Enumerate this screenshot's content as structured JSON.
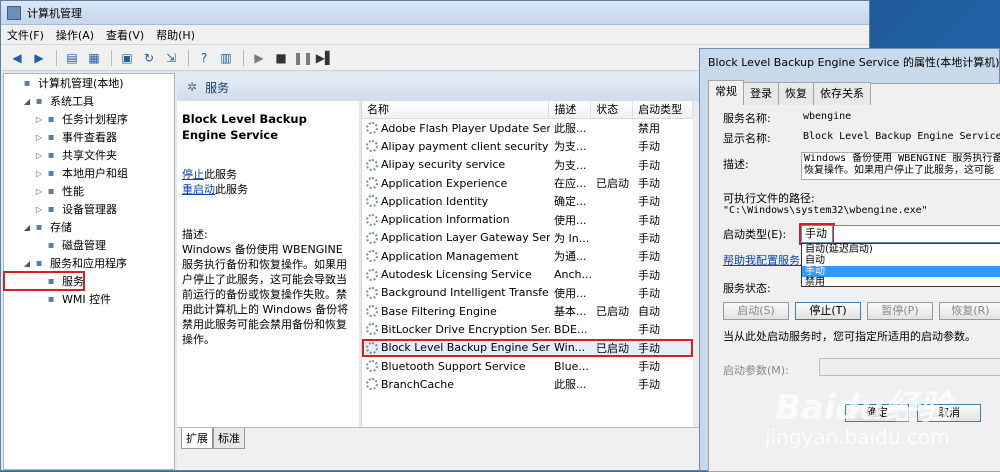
{
  "main_title": "计算机管理",
  "menu": [
    "文件(F)",
    "操作(A)",
    "查看(V)",
    "帮助(H)"
  ],
  "tree": [
    {
      "label": "计算机管理(本地)",
      "level": 0
    },
    {
      "label": "系统工具",
      "level": 1
    },
    {
      "label": "任务计划程序",
      "level": 2
    },
    {
      "label": "事件查看器",
      "level": 2
    },
    {
      "label": "共享文件夹",
      "level": 2
    },
    {
      "label": "本地用户和组",
      "level": 2
    },
    {
      "label": "性能",
      "level": 2
    },
    {
      "label": "设备管理器",
      "level": 2
    },
    {
      "label": "存储",
      "level": 1
    },
    {
      "label": "磁盘管理",
      "level": 2
    },
    {
      "label": "服务和应用程序",
      "level": 1
    },
    {
      "label": "服务",
      "level": 2,
      "selected": true
    },
    {
      "label": "WMI 控件",
      "level": 2
    }
  ],
  "services_header": "服务",
  "detail": {
    "title": "Block Level Backup Engine Service",
    "stop_link": "停止",
    "stop_rest": "此服务",
    "restart_link": "重启动",
    "restart_rest": "此服务",
    "desc_label": "描述:",
    "desc_text": "Windows 备份使用 WBENGINE 服务执行备份和恢复操作。如果用户停止了此服务，这可能会导致当前运行的备份或恢复操作失败。禁用此计算机上的 Windows 备份将禁用此服务可能会禁用备份和恢复操作。"
  },
  "columns": [
    "名称",
    "描述",
    "状态",
    "启动类型"
  ],
  "rows": [
    [
      "Adobe Flash Player Update Ser...",
      "此服...",
      "",
      "禁用"
    ],
    [
      "Alipay payment client security ...",
      "为支...",
      "",
      "手动"
    ],
    [
      "Alipay security service",
      "为支...",
      "",
      "手动"
    ],
    [
      "Application Experience",
      "在应...",
      "已启动",
      "手动"
    ],
    [
      "Application Identity",
      "确定...",
      "",
      "手动"
    ],
    [
      "Application Information",
      "使用...",
      "",
      "手动"
    ],
    [
      "Application Layer Gateway Ser...",
      "为 In...",
      "",
      "手动"
    ],
    [
      "Application Management",
      "为通...",
      "",
      "手动"
    ],
    [
      "Autodesk Licensing Service",
      "Anch...",
      "",
      "手动"
    ],
    [
      "Background Intelligent Transfe...",
      "使用...",
      "",
      "手动"
    ],
    [
      "Base Filtering Engine",
      "基本...",
      "已启动",
      "自动"
    ],
    [
      "BitLocker Drive Encryption Ser...",
      "BDE...",
      "",
      "手动"
    ],
    [
      "Block Level Backup Engine Ser...",
      "Win...",
      "已启动",
      "手动"
    ],
    [
      "Bluetooth Support Service",
      "Blue...",
      "",
      "手动"
    ],
    [
      "BranchCache",
      "此服...",
      "",
      "手动"
    ]
  ],
  "bottom_tabs": [
    "扩展",
    "标准"
  ],
  "dialog": {
    "title": "Block Level Backup Engine Service 的属性(本地计算机)",
    "tabs": [
      "常规",
      "登录",
      "恢复",
      "依存关系"
    ],
    "svc_name_label": "服务名称:",
    "svc_name": "wbengine",
    "disp_name_label": "显示名称:",
    "disp_name": "Block Level Backup Engine Service",
    "desc_label": "描述:",
    "desc1": "Windows 备份使用 WBENGINE 服务执行备份",
    "desc2": "恢复操作。如果用户停止了此服务，这可能",
    "path_label": "可执行文件的路径:",
    "path": "\"C:\\Windows\\system32\\wbengine.exe\"",
    "startup_label": "启动类型(E):",
    "startup_value": "手动",
    "options": [
      "自动(延迟启动)",
      "自动",
      "手动",
      "禁用"
    ],
    "help_link": "帮助我配置服务启",
    "status_label": "服务状态:",
    "buttons": [
      "启动(S)",
      "停止(T)",
      "暂停(P)",
      "恢复(R)"
    ],
    "hint": "当从此处启动服务时，您可指定所适用的启动参数。",
    "param_label": "启动参数(M):",
    "ok": "确定",
    "cancel": "取消"
  }
}
